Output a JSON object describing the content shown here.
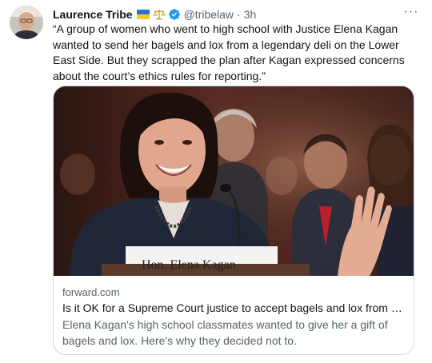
{
  "author": {
    "name": "Laurence Tribe",
    "flag_icon": "ukraine-flag-icon",
    "badge_icon": "scales-of-justice-icon",
    "verified_icon": "verified-badge-icon",
    "handle": "@tribelaw",
    "separator": "·",
    "time": "3h"
  },
  "more_button": {
    "label": "···",
    "icon": "more-icon"
  },
  "tweet_text": "“A group of women who went to high school with Justice Elena Kagan wanted to send her bagels and lox from a legendary deli on the Lower East Side. But they scrapped the plan after Kagan expressed concerns about the court’s ethics rules for reporting.”",
  "link_card": {
    "placard_text": "Hon. Elena Kagan",
    "domain": "forward.com",
    "headline": "Is it OK for a Supreme Court justice to accept bagels and lox from her high school classmates?",
    "description": "Elena Kagan's high school classmates wanted to give her a gift of bagels and lox. Here's why they decided not to."
  },
  "colors": {
    "text_primary": "#0f1419",
    "text_secondary": "#536471",
    "verified_blue": "#1d9bf0",
    "border": "#cfd9de"
  }
}
